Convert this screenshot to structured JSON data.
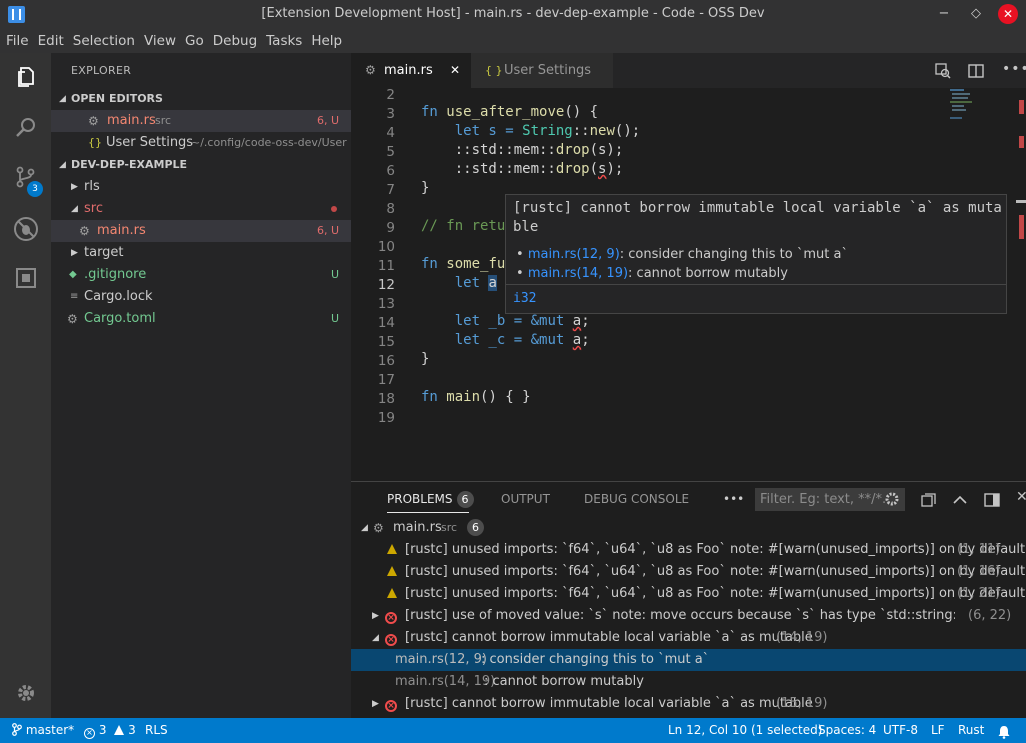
{
  "window": {
    "title": "[Extension Development Host] - main.rs - dev-dep-example - Code - OSS Dev",
    "minimize": "−",
    "maximize": "◇",
    "close": "✕"
  },
  "menu": [
    "File",
    "Edit",
    "Selection",
    "View",
    "Go",
    "Debug",
    "Tasks",
    "Help"
  ],
  "activity": {
    "scm_badge": "3"
  },
  "sidebar": {
    "title": "EXPLORER",
    "open_editors": {
      "label": "OPEN EDITORS",
      "items": [
        {
          "name": "main.rs",
          "desc": "src",
          "badge": "6, U"
        },
        {
          "name": "User Settings",
          "desc": "~/.config/code-oss-dev/User"
        }
      ]
    },
    "project": {
      "label": "DEV-DEP-EXAMPLE",
      "items": [
        {
          "name": "rls"
        },
        {
          "name": "src"
        },
        {
          "name": "main.rs",
          "badge": "6, U"
        },
        {
          "name": "target"
        },
        {
          "name": ".gitignore",
          "badge": "U"
        },
        {
          "name": "Cargo.lock"
        },
        {
          "name": "Cargo.toml",
          "badge": "U"
        }
      ]
    }
  },
  "tabs": [
    {
      "label": "main.rs",
      "close": "✕"
    },
    {
      "label": "User Settings",
      "icon": "{ }"
    }
  ],
  "editor": {
    "line_numbers": [
      "2",
      "3",
      "4",
      "5",
      "6",
      "7",
      "8",
      "9",
      "10",
      "11",
      "12",
      "13",
      "14",
      "15",
      "16",
      "17",
      "18",
      "19"
    ],
    "code": {
      "l3a": "fn ",
      "l3b": "use_after_move",
      "l3c": "() {",
      "l4a": "    let s = ",
      "l4b": "String",
      "l4c": "::",
      "l4d": "new",
      "l4e": "();",
      "l5a": "    ::std::mem::",
      "l5b": "drop",
      "l5c": "(s);",
      "l6a": "    ::std::mem::",
      "l6b": "drop",
      "l6c": "(",
      "l6d": "s",
      "l6e": ");",
      "l7": "}",
      "l9": "// fn retu",
      "l11a": "fn ",
      "l11b": "some_fu",
      "l12a": "    let ",
      "l12b": "a",
      "l14a": "    let _b = &",
      "l14b": "mut",
      "l14c": " ",
      "l14d": "a",
      "l14e": ";",
      "l15a": "    let _c = &",
      "l15b": "mut",
      "l15c": " ",
      "l15d": "a",
      "l15e": ";",
      "l16": "}",
      "l18a": "fn ",
      "l18b": "main",
      "l18c": "() { }"
    },
    "hover": {
      "message": "[rustc] cannot borrow immutable local variable `a` as mutable",
      "related": [
        {
          "link": "main.rs(12, 9)",
          "text": ": consider changing this to `mut a`"
        },
        {
          "link": "main.rs(14, 19)",
          "text": ": cannot borrow mutably"
        }
      ],
      "type": "i32"
    }
  },
  "panel": {
    "tabs": [
      "PROBLEMS",
      "OUTPUT",
      "DEBUG CONSOLE"
    ],
    "problems_count": "6",
    "more": "•••",
    "filter_placeholder": "Filter. Eg: text, **/*...",
    "file": {
      "name": "main.rs",
      "dir": "src",
      "count": "6"
    },
    "rows": [
      {
        "severity": "warning",
        "text": "[rustc] unused imports: `f64`, `u64`, `u8 as Foo` note: #[warn(unused_imports)] on by default",
        "loc": "(1, 11)"
      },
      {
        "severity": "warning",
        "text": "[rustc] unused imports: `f64`, `u64`, `u8 as Foo` note: #[warn(unused_imports)] on by default",
        "loc": "(1, 16)"
      },
      {
        "severity": "warning",
        "text": "[rustc] unused imports: `f64`, `u64`, `u8 as Foo` note: #[warn(unused_imports)] on by default",
        "loc": "(1, 21)"
      },
      {
        "severity": "error",
        "text": "[rustc] use of moved value: `s` note: move occurs because `s` has type `std::string::String`, which...",
        "loc": "(6, 22)"
      },
      {
        "severity": "error",
        "text": "[rustc] cannot borrow immutable local variable `a` as mutable",
        "loc": "(14, 19)"
      },
      {
        "severity": "related",
        "link": "main.rs(12, 9)",
        "text": ": consider changing this to `mut a`"
      },
      {
        "severity": "related",
        "link": "main.rs(14, 19)",
        "text": ": cannot borrow mutably"
      },
      {
        "severity": "error",
        "text": "[rustc] cannot borrow immutable local variable `a` as mutable",
        "loc": "(15, 19)"
      }
    ]
  },
  "status": {
    "branch": "master*",
    "errors": "3",
    "warnings": "3",
    "rls": "RLS",
    "position": "Ln 12, Col 10 (1 selected)",
    "spaces": "Spaces: 4",
    "encoding": "UTF-8",
    "eol": "LF",
    "language": "Rust"
  },
  "colors": {
    "accent": "#007acc",
    "error": "#f14c4c",
    "warning": "#cca700",
    "git_untracked": "#73c991"
  }
}
